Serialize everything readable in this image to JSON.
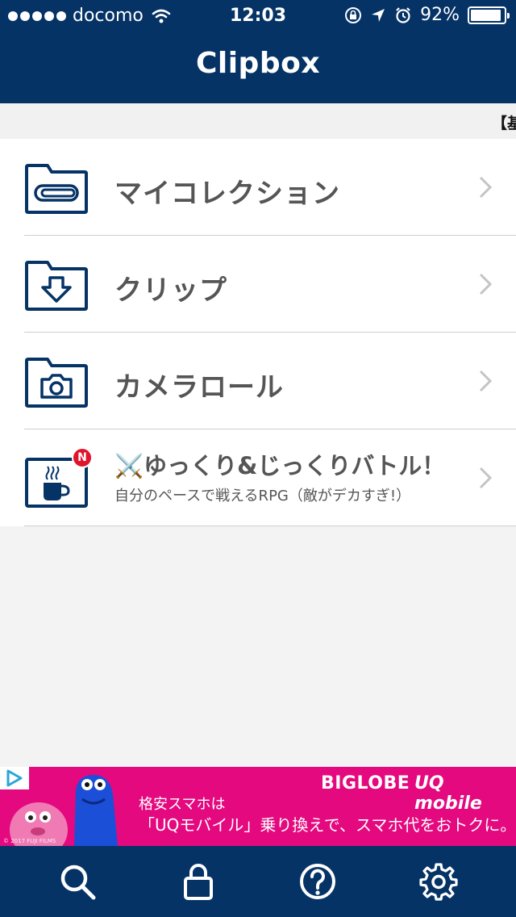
{
  "status_bar": {
    "carrier": "docomo",
    "time": "12:03",
    "battery": "92%",
    "battery_level": 0.92
  },
  "header": {
    "title": "Clipbox"
  },
  "ticker": {
    "text": "【基"
  },
  "menu": {
    "my_collection": "マイコレクション",
    "clip": "クリップ",
    "camera_roll": "カメラロール",
    "promo_title": "⚔️ゆっくり&じっくりバトル！",
    "promo_subtitle": "自分のペースで戦えるRPG（敵がデカすぎ!）",
    "promo_badge": "N"
  },
  "ad": {
    "brand1": "BIGLOBE",
    "brand2": "UQ mobile",
    "line1": "格安スマホは",
    "line2": "「UQモバイル」乗り換えで、スマホ代をおトクに。",
    "copyright": "© 2017 FUJI FILMS"
  },
  "colors": {
    "navy": "#053366",
    "ad_pink": "#e4097f",
    "badge_red": "#e0142b"
  },
  "icons": [
    "folder-paperclip-icon",
    "folder-download-icon",
    "folder-camera-icon",
    "coffee-cup-icon",
    "search-icon",
    "lock-icon",
    "help-icon",
    "gear-icon"
  ]
}
